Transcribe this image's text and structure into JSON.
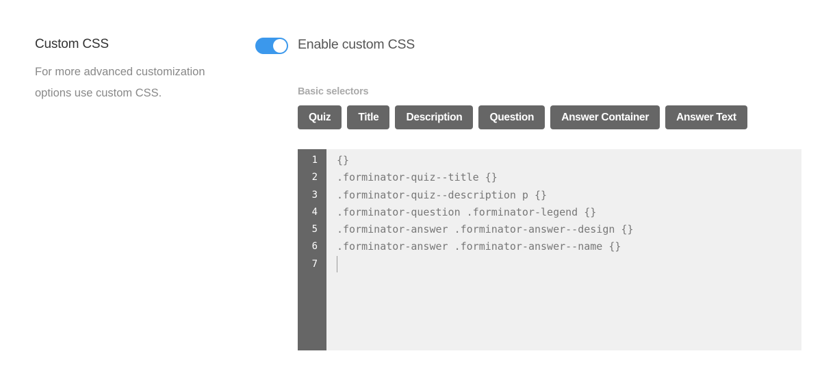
{
  "section": {
    "title": "Custom CSS",
    "description": "For more advanced customization options use custom CSS."
  },
  "toggle": {
    "label": "Enable custom CSS",
    "enabled": true,
    "color": "#3b98ec"
  },
  "selectors": {
    "label": "Basic selectors",
    "buttons": [
      "Quiz",
      "Title",
      "Description",
      "Question",
      "Answer Container",
      "Answer Text"
    ]
  },
  "editor": {
    "line_numbers": [
      "1",
      "2",
      "3",
      "4",
      "5",
      "6",
      "7"
    ],
    "lines": [
      "{}",
      ".forminator-quiz--title {}",
      ".forminator-quiz--description p {}",
      ".forminator-question .forminator-legend {}",
      ".forminator-answer .forminator-answer--design {}",
      ".forminator-answer .forminator-answer--name {}",
      ""
    ]
  }
}
